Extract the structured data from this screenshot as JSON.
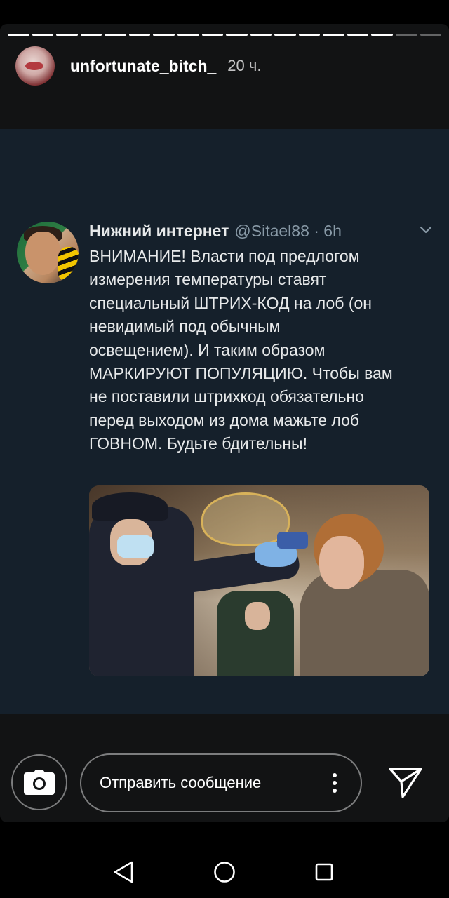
{
  "story": {
    "progress_segments_total": 18,
    "progress_segments_done": 16,
    "username": "unfortunate_bitch_",
    "time_ago": "20 ч."
  },
  "tweet": {
    "display_name": "Нижний интернет",
    "handle_time": "@Sitael88 · 6h",
    "text": "ВНИМАНИЕ! Власти под предлогом\nизмерения температуры ставят\nспециальный ШТРИХ-КОД на лоб (он\nневидимый под обычным\nосвещением). И таким образом\nМАРКИРУЮТ ПОПУЛЯЦИЮ. Чтобы вам\nне поставили штрихкод обязательно\nперед выходом из дома мажьте лоб\nГОВНОМ. Будьте бдительны!",
    "photo_icon": "photo-officer-measuring-temperature"
  },
  "reply_bar": {
    "placeholder": "Отправить сообщение",
    "camera_icon": "camera-icon",
    "more_icon": "more-vertical-icon",
    "send_icon": "send-icon"
  },
  "navbar": {
    "back_icon": "back-icon",
    "home_icon": "home-icon",
    "recent_icon": "recent-apps-icon"
  },
  "colors": {
    "background": "#000000",
    "story_panel": "#121314",
    "tweet_background": "#15202b",
    "tweet_text": "#e7e9ea",
    "tweet_secondary": "#8899a6"
  }
}
